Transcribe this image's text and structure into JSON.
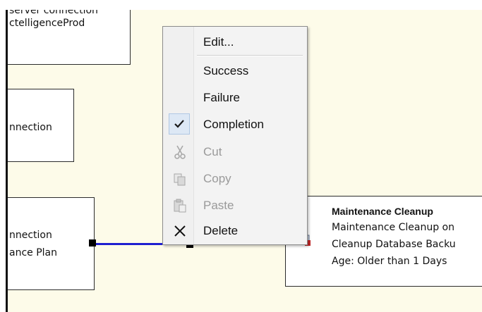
{
  "canvas": {
    "tasks": [
      {
        "lines": [
          "server connection",
          "ctelligenceProd"
        ]
      },
      {
        "lines": [
          "nnection"
        ]
      },
      {
        "lines": [
          "nnection",
          "ance Plan"
        ]
      }
    ],
    "maintenance_task": {
      "title": "Maintenance Cleanup",
      "line1": "Maintenance Cleanup on",
      "line2": "Cleanup Database Backu",
      "line3": "Age: Older than 1 Days",
      "icon": "maintenance-cleanup-task-icon"
    },
    "connector_color": "#1f1fd0",
    "background_color": "#fdfbe9"
  },
  "context_menu": {
    "items": [
      {
        "label": "Edit...",
        "enabled": true
      },
      {
        "label": "Success",
        "enabled": true
      },
      {
        "label": "Failure",
        "enabled": true
      },
      {
        "label": "Completion",
        "enabled": true,
        "checked": true,
        "icon": "check-icon"
      },
      {
        "label": "Cut",
        "enabled": false,
        "icon": "scissors-icon"
      },
      {
        "label": "Copy",
        "enabled": false,
        "icon": "copy-icon"
      },
      {
        "label": "Paste",
        "enabled": false,
        "icon": "paste-icon"
      },
      {
        "label": "Delete",
        "enabled": true,
        "icon": "delete-x-icon"
      }
    ]
  }
}
